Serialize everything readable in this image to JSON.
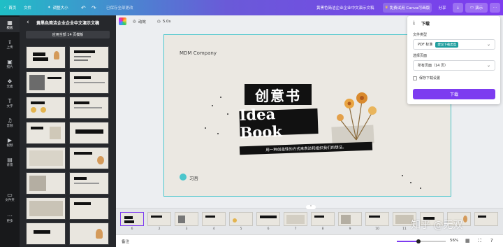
{
  "topbar": {
    "home": "首页",
    "file": "文件",
    "resize": "调整大小",
    "undo_icon": "undo-icon",
    "redo_icon": "redo-icon",
    "save_status": "已保存全部更改",
    "doc_title": "黄黑色简洁企业企业中文演示文稿",
    "trial_button": "免费试用 Canva可画版",
    "share_button": "分享",
    "present_button": "演示",
    "more_icon": "more-icon"
  },
  "leftrail": [
    {
      "label": "模板",
      "icon": "▦"
    },
    {
      "label": "上传",
      "icon": "⇪"
    },
    {
      "label": "照片",
      "icon": "▣"
    },
    {
      "label": "元素",
      "icon": "❖"
    },
    {
      "label": "文字",
      "icon": "T"
    },
    {
      "label": "音频",
      "icon": "♫"
    },
    {
      "label": "视频",
      "icon": "▶"
    },
    {
      "label": "背景",
      "icon": "▤"
    },
    {
      "label": "文件夹",
      "icon": "▭"
    },
    {
      "label": "更多",
      "icon": "⋯"
    }
  ],
  "panel": {
    "title": "黄黑色简洁企业企业中文演示文稿",
    "apply_all": "应用全部 14 页模板",
    "thumb_text": [
      "创意书",
      "Idea Book",
      "",
      "",
      "",
      "",
      "",
      "",
      "",
      "",
      "",
      "",
      "",
      ""
    ]
  },
  "canvas_toolbar": {
    "animate": "动效",
    "duration": "5.0s"
  },
  "slide": {
    "company": "MDM Company",
    "title_cn": "创意书",
    "title_en": "Idea Book",
    "subtitle": "用一种创造性的方式来表达和组织我们的想法。",
    "logo_text": "习吾"
  },
  "download": {
    "title": "下载",
    "file_type_label": "文件类型",
    "file_type_value": "PDF 标准",
    "file_type_badge": "建议下载类型",
    "pages_label": "选择页面",
    "pages_value": "所有页面（14 页）",
    "save_settings": "保存下载设置",
    "download_button": "下载"
  },
  "strip": {
    "page_numbers": [
      "6",
      "2",
      "3",
      "4",
      "5",
      "6",
      "7",
      "8",
      "9",
      "10",
      "11"
    ]
  },
  "bottombar": {
    "notes": "备注",
    "zoom": "56%"
  },
  "watermark": "知乎 @无双",
  "colors": {
    "accent": "#7d3cf0",
    "teal": "#1fbfc6",
    "selection": "#4cc6cc"
  }
}
